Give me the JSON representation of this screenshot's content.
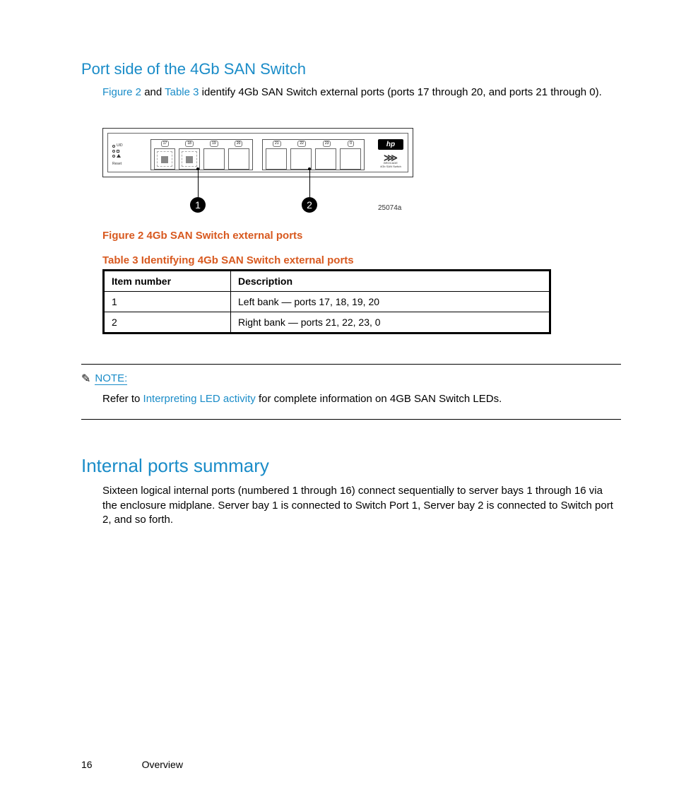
{
  "heading1": "Port side of the 4Gb SAN Switch",
  "intro": {
    "pre": "",
    "link1": "Figure 2",
    "mid1": " and ",
    "link2": "Table 3",
    "post": " identify 4Gb SAN Switch external ports (ports 17 through 20, and ports 21 through 0)."
  },
  "diagram": {
    "uid_label": "UID",
    "reset_label": "Reset",
    "group1_ports": [
      "17",
      "18",
      "19",
      "20"
    ],
    "group2_ports": [
      "21",
      "22",
      "23",
      "0"
    ],
    "hp": "hp",
    "brocade_label": "BROCADE",
    "brocade_sub": "4Gb SAN Switch",
    "callout1": "1",
    "callout2": "2",
    "figure_id": "25074a"
  },
  "figure_caption": "Figure 2 4Gb SAN Switch external ports",
  "table_caption": "Table 3 Identifying 4Gb SAN Switch external ports",
  "table": {
    "head": [
      "Item number",
      "Description"
    ],
    "rows": [
      [
        "1",
        "Left bank — ports 17, 18, 19, 20"
      ],
      [
        "2",
        "Right bank — ports 21, 22, 23, 0"
      ]
    ]
  },
  "note": {
    "label": "NOTE:",
    "pre": "Refer to ",
    "link": "Interpreting LED activity",
    "post": " for complete information on 4GB SAN Switch LEDs."
  },
  "heading2": "Internal ports summary",
  "summary_text": "Sixteen logical internal ports (numbered 1 through 16) connect sequentially to server bays 1 through 16 via the enclosure midplane. Server bay 1 is connected to Switch Port 1, Server bay 2 is connected to Switch port 2, and so forth.",
  "footer": {
    "page": "16",
    "section": "Overview"
  }
}
